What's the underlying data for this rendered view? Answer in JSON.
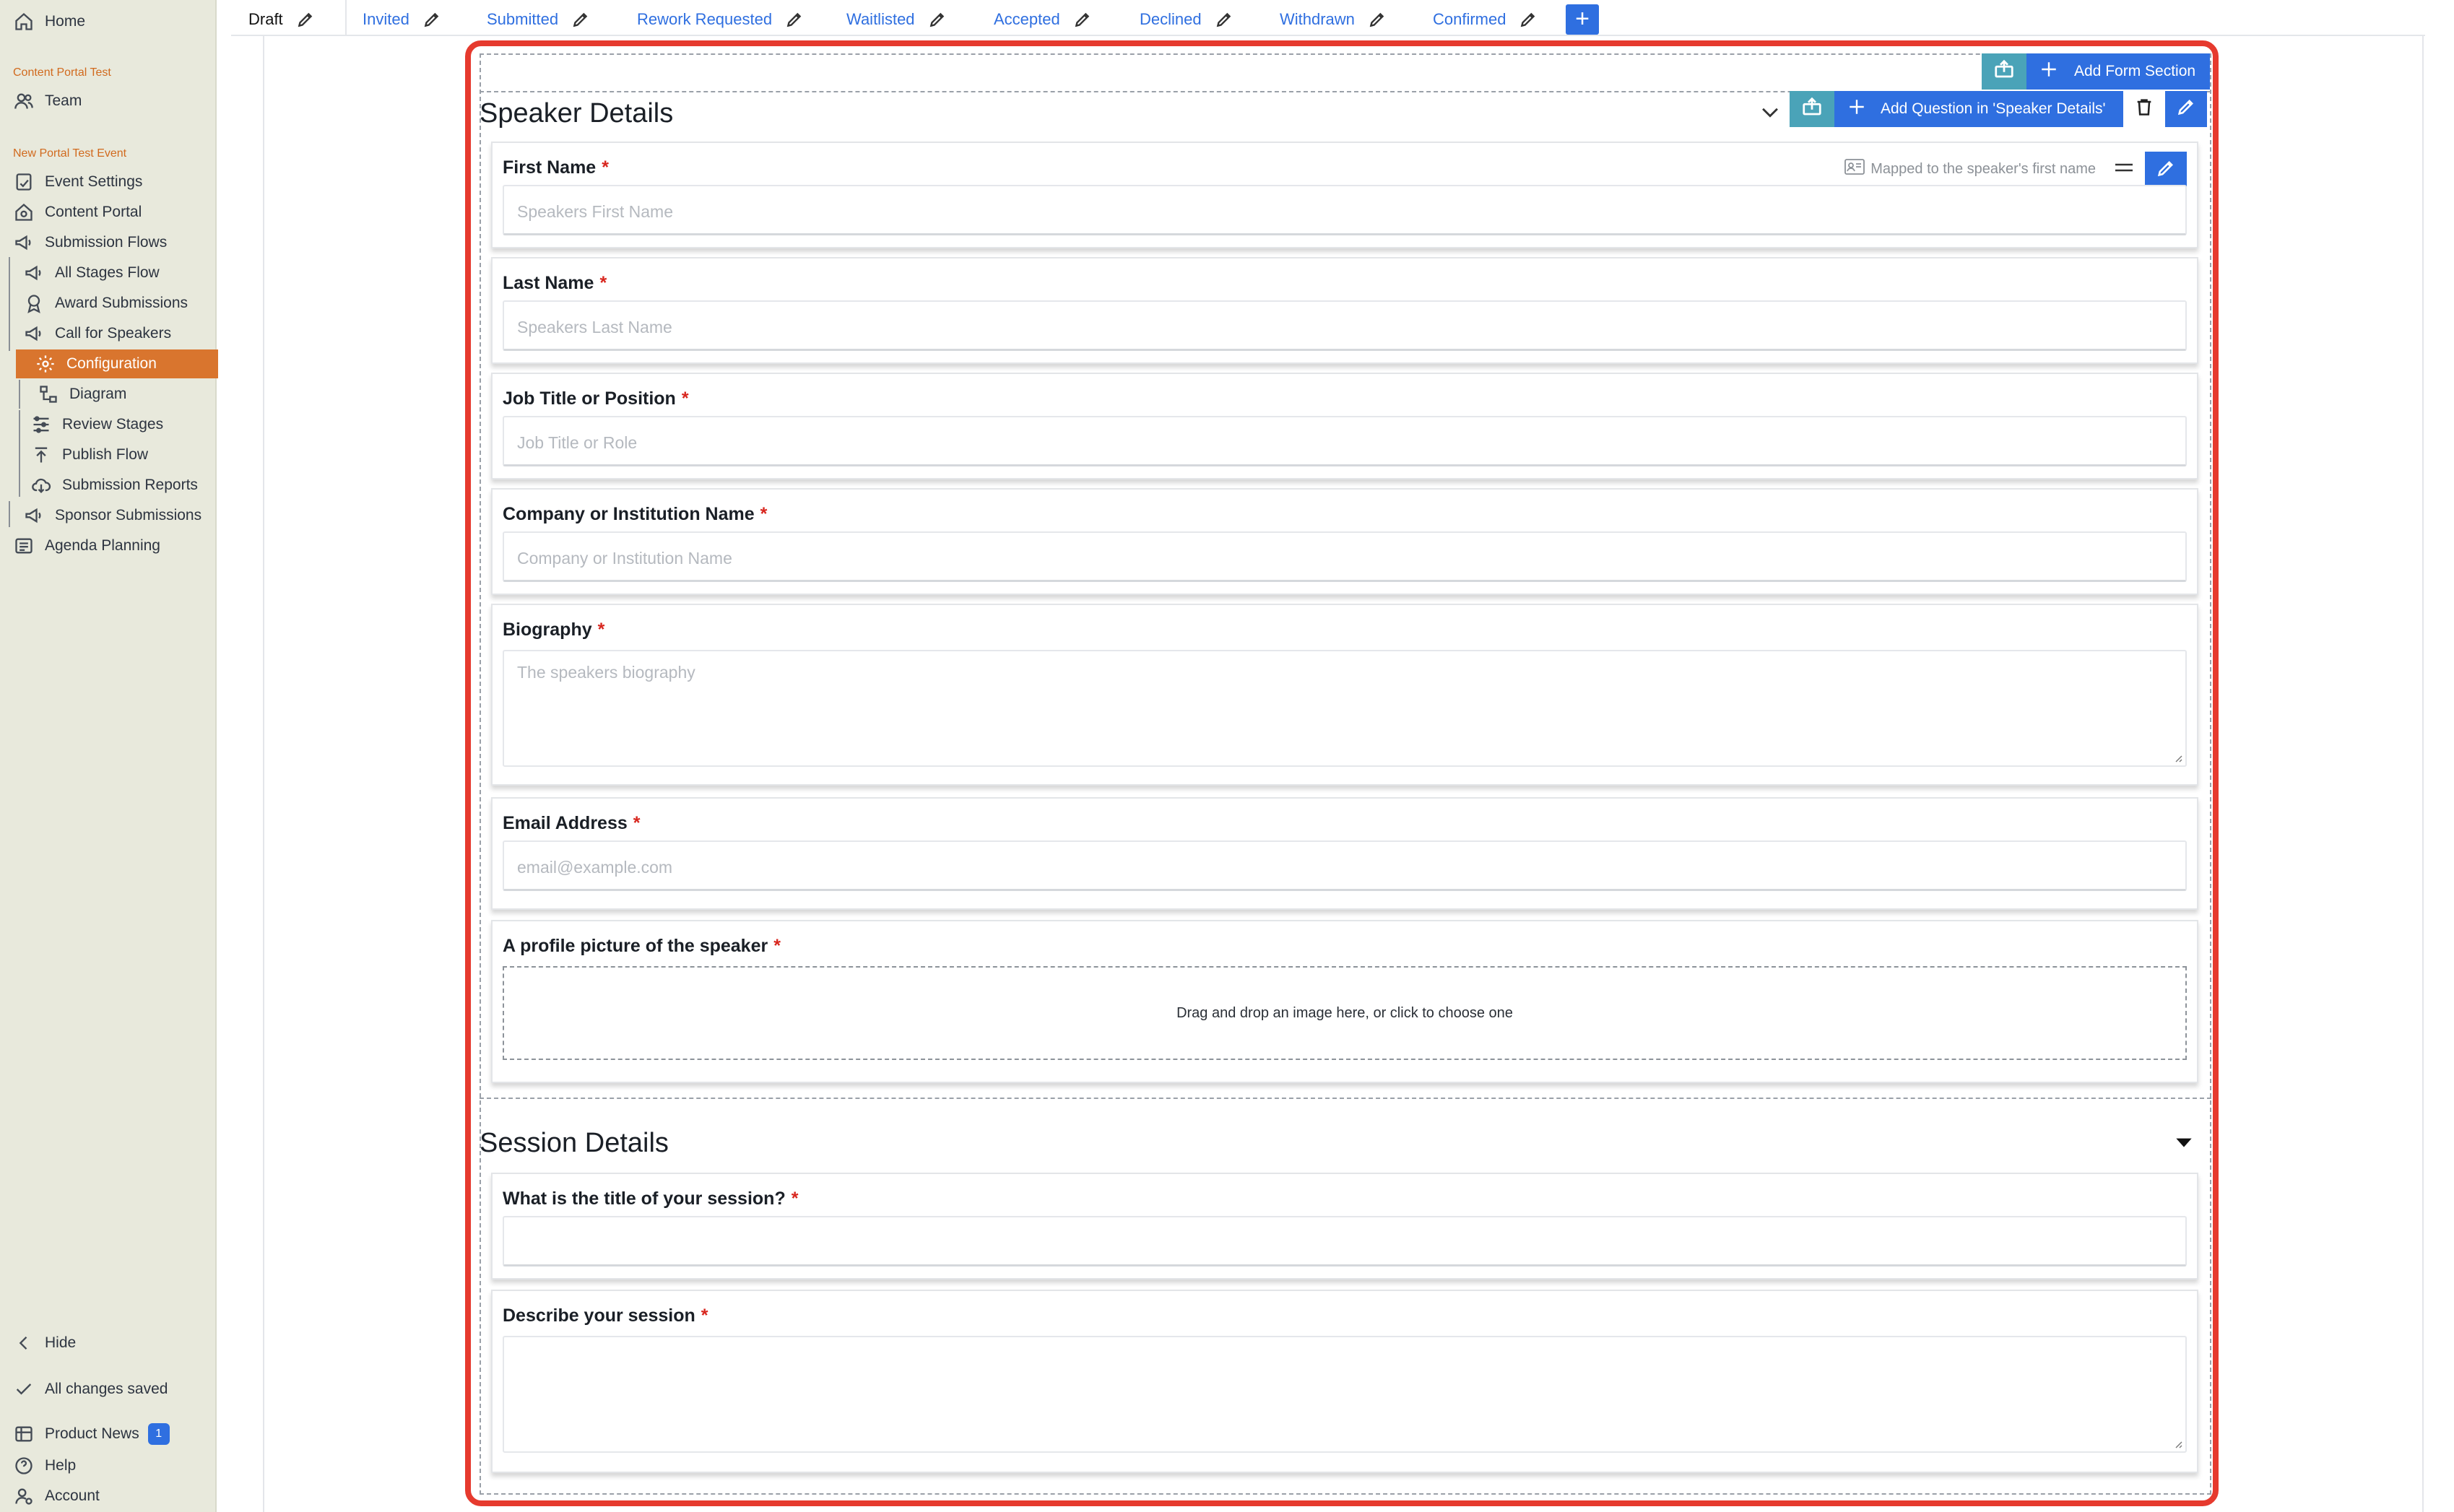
{
  "sidebar": {
    "home": "Home",
    "portal1_label": "Content Portal Test",
    "team": "Team",
    "portal2_label": "New Portal Test Event",
    "items": [
      {
        "label": "Event Settings",
        "icon": "settings-doc-icon"
      },
      {
        "label": "Content Portal",
        "icon": "portal-home-icon"
      },
      {
        "label": "Submission Flows",
        "icon": "megaphone-icon"
      },
      {
        "label": "All Stages Flow",
        "icon": "megaphone-icon"
      },
      {
        "label": "Award Submissions",
        "icon": "award-icon"
      },
      {
        "label": "Call for Speakers",
        "icon": "megaphone-icon"
      },
      {
        "label": "Configuration",
        "icon": "gear-icon"
      },
      {
        "label": "Diagram",
        "icon": "diagram-icon"
      },
      {
        "label": "Review Stages",
        "icon": "review-stages-icon"
      },
      {
        "label": "Publish Flow",
        "icon": "publish-icon"
      },
      {
        "label": "Submission Reports",
        "icon": "cloud-download-icon"
      },
      {
        "label": "Sponsor Submissions",
        "icon": "megaphone-icon"
      },
      {
        "label": "Agenda Planning",
        "icon": "list-icon"
      }
    ],
    "hide": "Hide",
    "saved": "All changes saved",
    "product_news": "Product News",
    "product_news_badge": "1",
    "help": "Help",
    "account": "Account"
  },
  "tabs": [
    {
      "label": "Draft"
    },
    {
      "label": "Invited"
    },
    {
      "label": "Submitted"
    },
    {
      "label": "Rework Requested"
    },
    {
      "label": "Waitlisted"
    },
    {
      "label": "Accepted"
    },
    {
      "label": "Declined"
    },
    {
      "label": "Withdrawn"
    },
    {
      "label": "Confirmed"
    }
  ],
  "add_tab": "+",
  "toolbar": {
    "add_form_section": "Add Form Section",
    "add_question": "Add Question in 'Speaker Details'"
  },
  "sections": [
    {
      "title": "Speaker Details",
      "questions": [
        {
          "label": "First Name",
          "required": "*",
          "placeholder": "Speakers First Name",
          "mapped": "Mapped to the speaker's first name"
        },
        {
          "label": "Last Name",
          "required": "*",
          "placeholder": "Speakers Last Name"
        },
        {
          "label": "Job Title or Position",
          "required": "*",
          "placeholder": "Job Title or Role"
        },
        {
          "label": "Company or Institution Name",
          "required": "*",
          "placeholder": "Company or Institution Name"
        },
        {
          "label": "Biography",
          "required": "*",
          "placeholder": "The speakers biography"
        },
        {
          "label": "Email Address",
          "required": "*",
          "placeholder": "email@example.com"
        },
        {
          "label": "A profile picture of the speaker",
          "required": "*",
          "dropzone": "Drag and drop an image here, or click to choose one"
        }
      ]
    },
    {
      "title": "Session Details",
      "questions": [
        {
          "label": "What is the title of your session?",
          "required": "*",
          "placeholder": ""
        },
        {
          "label": "Describe your session",
          "required": "*",
          "placeholder": ""
        }
      ]
    }
  ],
  "colors": {
    "accent_blue": "#2f6fe0",
    "teal": "#4aa3b8",
    "active_orange": "#d9752e",
    "highlight_red": "#e63a2e",
    "required_red": "#d8261e",
    "sidebar_bg": "#e8e9dc"
  }
}
